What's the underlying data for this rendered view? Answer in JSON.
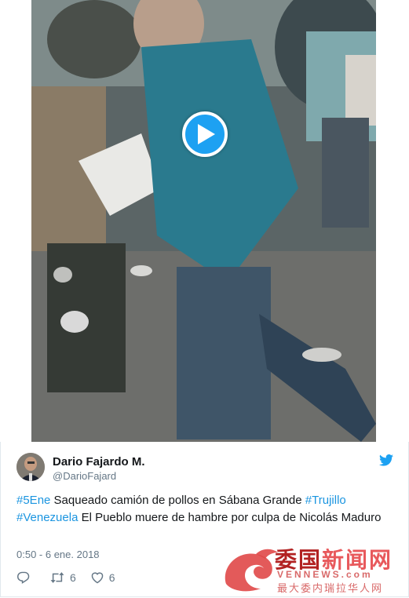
{
  "video": {
    "play_label": "Play video",
    "colors": {
      "play_button": "#1da1f2"
    }
  },
  "tweet": {
    "author_name": "Dario Fajardo M.",
    "author_handle": "@DarioFajard",
    "text_parts": [
      {
        "text": "#5Ene",
        "hashtag": true
      },
      {
        "text": " Saqueado camión de pollos en Sábana Grande ",
        "hashtag": false
      },
      {
        "text": "#Trujillo",
        "hashtag": true
      },
      {
        "text": " ",
        "hashtag": false
      },
      {
        "text": "#Venezuela",
        "hashtag": true
      },
      {
        "text": " El Pueblo muere de hambre por culpa de Nicolás Maduro",
        "hashtag": false
      }
    ],
    "timestamp": "0:50 - 6 ene. 2018",
    "retweet_count": "6",
    "like_count": "6",
    "icons": [
      "twitter-bird-icon",
      "reply-icon",
      "retweet-icon",
      "like-icon"
    ],
    "colors": {
      "link": "#1b95e0",
      "bird": "#1da1f2",
      "secondary_text": "#657786"
    }
  },
  "watermark": {
    "title_part1": "委国",
    "title_part2": "新闻网",
    "domain": "VENNEWS.com",
    "subtitle": "最大委内瑞拉华人网"
  }
}
